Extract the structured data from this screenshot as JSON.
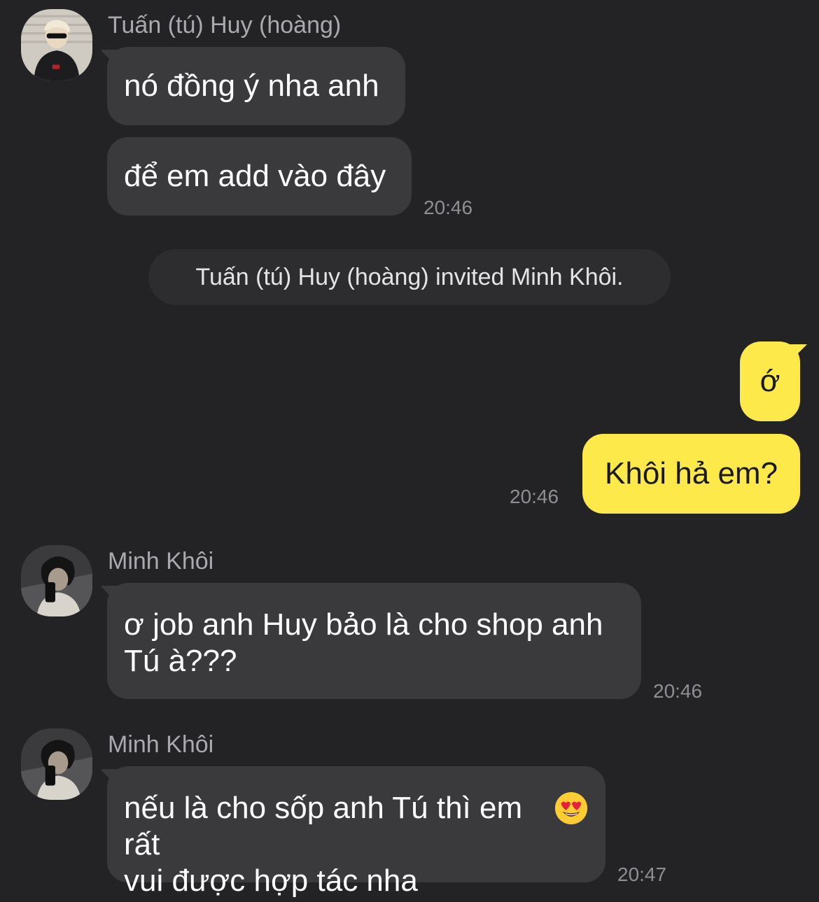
{
  "colors": {
    "background": "#232326",
    "incoming_bubble": "#3a3a3d",
    "outgoing_bubble": "#fde94a",
    "system_pill": "#2d2d30",
    "meta_text": "#8e8e93"
  },
  "messages": {
    "group1": {
      "sender": "Tuấn (tú) Huy (hoàng)",
      "bubble1": "nó đồng ý nha anh",
      "bubble2": "để em add vào đây",
      "time": "20:46"
    },
    "system": {
      "text": "Tuấn (tú) Huy (hoàng) invited Minh Khôi."
    },
    "group2": {
      "bubble1": "ớ",
      "bubble2": "Khôi hả em?",
      "time": "20:46"
    },
    "group3": {
      "sender": "Minh Khôi",
      "bubble1": "ơ job anh Huy bảo là cho shop anh\nTú à???",
      "time": "20:46"
    },
    "group4": {
      "sender": "Minh Khôi",
      "bubble1": "nếu là cho sốp anh Tú thì em rất\nvui được hợp tác nha",
      "emoji": "smiling-face-with-heart-eyes",
      "time": "20:47"
    }
  }
}
